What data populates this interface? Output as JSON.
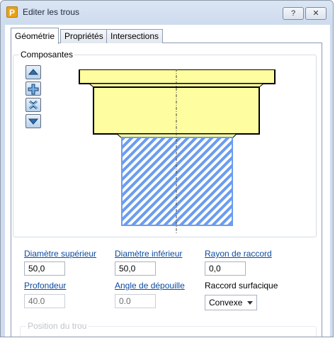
{
  "window": {
    "title": "Editer les trous",
    "app_icon_letter": "P",
    "help_label": "?",
    "close_label": "✕"
  },
  "tabs": [
    {
      "label": "Géométrie",
      "active": true
    },
    {
      "label": "Propriétés",
      "active": false
    },
    {
      "label": "Intersections",
      "active": false
    }
  ],
  "components": {
    "label": "Composantes",
    "buttons": [
      "move-up-icon",
      "add-icon",
      "delete-icon",
      "move-down-icon"
    ]
  },
  "fields": {
    "diametre_superieur": {
      "label": "Diamètre supérieur",
      "value": "50,0"
    },
    "diametre_inferieur": {
      "label": "Diamètre inférieur",
      "value": "50,0"
    },
    "rayon_raccord": {
      "label": "Rayon de raccord",
      "value": "0,0"
    },
    "profondeur": {
      "label": "Profondeur",
      "value": "40.0"
    },
    "angle_depouille": {
      "label": "Angle de dépouille",
      "value": "0.0"
    },
    "raccord_surfacique": {
      "label": "Raccord surfacique",
      "value": "Convexe"
    }
  },
  "position": {
    "label": "Position du trou"
  },
  "colors": {
    "shape_fill": "#fefea0",
    "hatch_blue": "#6a9cf0",
    "link": "#0b4a9e"
  }
}
